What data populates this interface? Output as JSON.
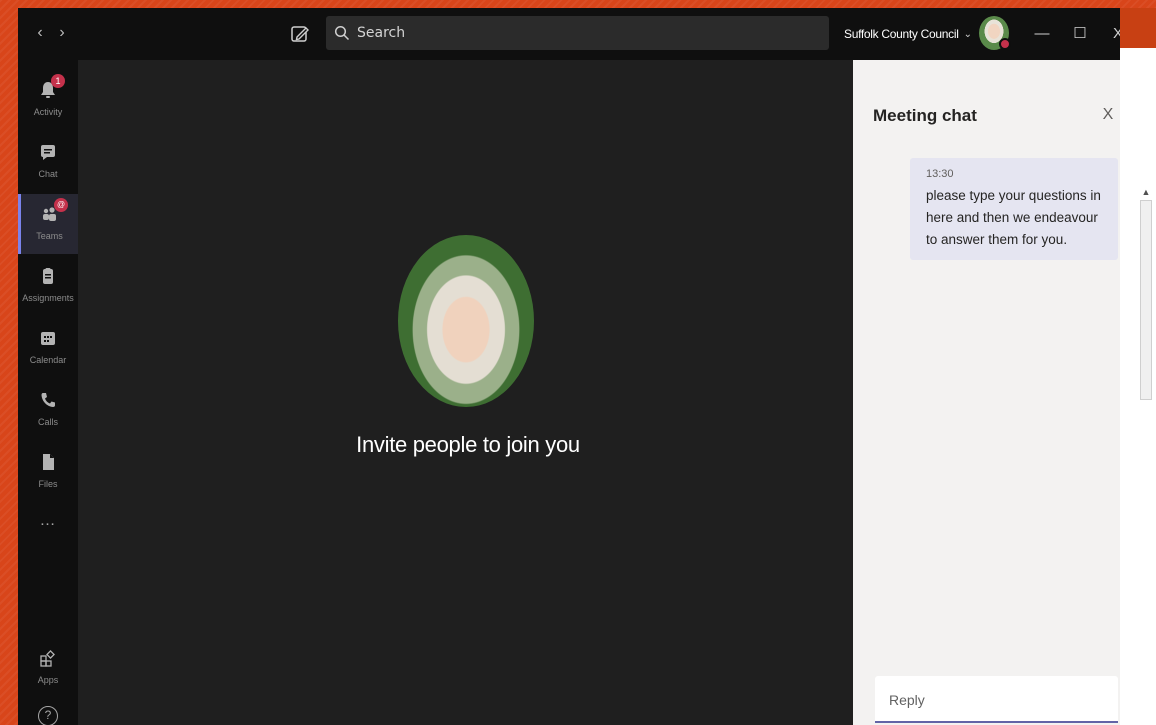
{
  "titlebar": {
    "back_label": "‹",
    "forward_label": "›",
    "search_placeholder": "Search",
    "org_name": "Suffolk County Council",
    "org_chevron": "⌄",
    "minimize_label": "—",
    "maximize_label": "☐",
    "close_label": "X"
  },
  "rail": {
    "items": [
      {
        "label": "Activity",
        "badge": "1",
        "icon": "bell-icon"
      },
      {
        "label": "Chat",
        "icon": "chat-icon"
      },
      {
        "label": "Teams",
        "badge": "@",
        "icon": "teams-icon",
        "active": true
      },
      {
        "label": "Assignments",
        "icon": "assignments-icon"
      },
      {
        "label": "Calendar",
        "icon": "calendar-icon"
      },
      {
        "label": "Calls",
        "icon": "phone-icon"
      },
      {
        "label": "Files",
        "icon": "file-icon"
      },
      {
        "label": "…",
        "icon": "more-icon"
      },
      {
        "label": "Apps",
        "icon": "apps-icon"
      },
      {
        "label": "?",
        "icon": "help-icon"
      }
    ]
  },
  "stage": {
    "invite_text": "Invite people to join you"
  },
  "chat": {
    "title": "Meeting chat",
    "close_label": "X",
    "message": {
      "time": "13:30",
      "text": "please type your questions in here and then we endeavour to answer them for you."
    },
    "reply_placeholder": "Reply"
  },
  "colors": {
    "accent": "#6264a7",
    "badge": "#c4314b",
    "rail_bg": "#0f0f0f",
    "stage_bg": "#1f1f1f",
    "chat_bg": "#f3f2f1",
    "message_bg": "#e5e5f1",
    "desktop_bg": "#d8451a"
  }
}
